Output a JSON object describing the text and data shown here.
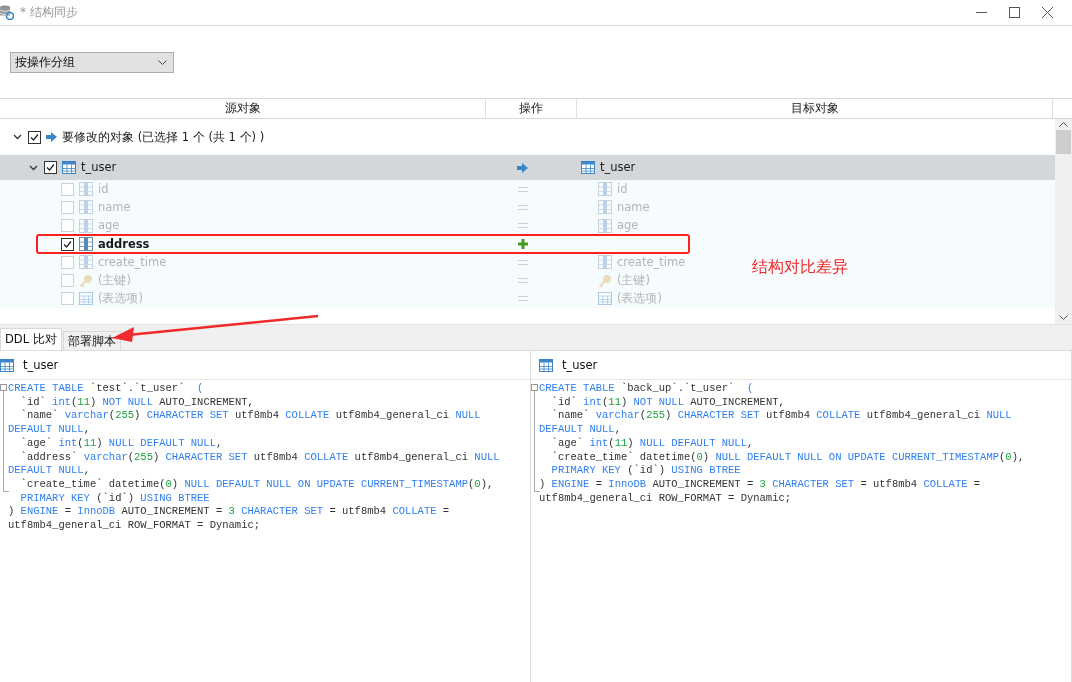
{
  "window": {
    "title": "* 结构同步"
  },
  "group_by": {
    "value": "按操作分组"
  },
  "columns": [
    "源对象",
    "操作",
    "目标对象"
  ],
  "groups": [
    {
      "label": "要修改的对象 (已选择 1 个 (共 1 个) )",
      "checked": true,
      "expanded": true,
      "op": {
        "kind": "modify"
      },
      "tables": [
        {
          "name": "t_user",
          "checked": true,
          "expanded": true,
          "selected": true,
          "op": {
            "kind": "modify"
          },
          "target": "t_user",
          "children": [
            {
              "kind": "column",
              "name": "id",
              "checked": false,
              "op": {
                "kind": "equal"
              },
              "target": "id"
            },
            {
              "kind": "column",
              "name": "name",
              "checked": false,
              "op": {
                "kind": "equal"
              },
              "target": "name"
            },
            {
              "kind": "column",
              "name": "age",
              "checked": false,
              "op": {
                "kind": "equal"
              },
              "target": "age"
            },
            {
              "kind": "column",
              "name": "address",
              "checked": true,
              "op": {
                "kind": "add"
              }
            },
            {
              "kind": "column",
              "name": "create_time",
              "checked": false,
              "op": {
                "kind": "equal"
              },
              "target": "create_time"
            },
            {
              "kind": "key",
              "name": "(主键)",
              "checked": false,
              "op": {
                "kind": "equal"
              },
              "target": "(主键)"
            },
            {
              "kind": "options",
              "name": "(表选项)",
              "checked": false,
              "op": {
                "kind": "equal"
              },
              "target": "(表选项)"
            }
          ]
        }
      ]
    }
  ],
  "annotation": {
    "label": "结构对比差异"
  },
  "tabs": [
    {
      "label": "DDL 比对",
      "selected": true
    },
    {
      "label": "部署脚本",
      "selected": false
    }
  ],
  "panes": [
    {
      "title": "t_user",
      "lines": [
        [
          {
            "t": "CREATE TABLE",
            "kind": "kw"
          },
          {
            "t": " `test`.`t_user`  ",
            "kind": "txt"
          },
          {
            "t": "(",
            "kind": "kw"
          }
        ],
        [
          {
            "t": "  `id` ",
            "kind": "txt"
          },
          {
            "t": "int",
            "kind": "kw"
          },
          {
            "t": "(",
            "kind": "txt"
          },
          {
            "t": "11",
            "kind": "num"
          },
          {
            "t": ") ",
            "kind": "txt"
          },
          {
            "t": "NOT NULL",
            "kind": "kw"
          },
          {
            "t": " AUTO_INCREMENT,",
            "kind": "txt"
          }
        ],
        [
          {
            "t": "  `name` ",
            "kind": "txt"
          },
          {
            "t": "varchar",
            "kind": "kw"
          },
          {
            "t": "(",
            "kind": "txt"
          },
          {
            "t": "255",
            "kind": "num"
          },
          {
            "t": ") ",
            "kind": "txt"
          },
          {
            "t": "CHARACTER SET",
            "kind": "kw"
          },
          {
            "t": " utf8mb4 ",
            "kind": "txt"
          },
          {
            "t": "COLLATE",
            "kind": "kw"
          },
          {
            "t": " utf8mb4_general_ci ",
            "kind": "txt"
          },
          {
            "t": "NULL",
            "kind": "kw"
          }
        ],
        [
          {
            "t": "DEFAULT NULL",
            "kind": "kw"
          },
          {
            "t": ",",
            "kind": "txt"
          }
        ],
        [
          {
            "t": "  `age` ",
            "kind": "txt"
          },
          {
            "t": "int",
            "kind": "kw"
          },
          {
            "t": "(",
            "kind": "txt"
          },
          {
            "t": "11",
            "kind": "num"
          },
          {
            "t": ") ",
            "kind": "txt"
          },
          {
            "t": "NULL DEFAULT NULL",
            "kind": "kw"
          },
          {
            "t": ",",
            "kind": "txt"
          }
        ],
        [
          {
            "t": "  `address` ",
            "kind": "txt"
          },
          {
            "t": "varchar",
            "kind": "kw"
          },
          {
            "t": "(",
            "kind": "txt"
          },
          {
            "t": "255",
            "kind": "num"
          },
          {
            "t": ") ",
            "kind": "txt"
          },
          {
            "t": "CHARACTER SET",
            "kind": "kw"
          },
          {
            "t": " utf8mb4 ",
            "kind": "txt"
          },
          {
            "t": "COLLATE",
            "kind": "kw"
          },
          {
            "t": " utf8mb4_general_ci ",
            "kind": "txt"
          },
          {
            "t": "NULL",
            "kind": "kw"
          }
        ],
        [
          {
            "t": "DEFAULT NULL",
            "kind": "kw"
          },
          {
            "t": ",",
            "kind": "txt"
          }
        ],
        [
          {
            "t": "  `create_time` datetime(",
            "kind": "txt"
          },
          {
            "t": "0",
            "kind": "num"
          },
          {
            "t": ") ",
            "kind": "txt"
          },
          {
            "t": "NULL DEFAULT NULL ON UPDATE CURRENT_TIMESTAMP",
            "kind": "kw"
          },
          {
            "t": "(",
            "kind": "txt"
          },
          {
            "t": "0",
            "kind": "num"
          },
          {
            "t": "),",
            "kind": "txt"
          }
        ],
        [
          {
            "t": "  PRIMARY KEY",
            "kind": "kw"
          },
          {
            "t": " (`id`) ",
            "kind": "txt"
          },
          {
            "t": "USING BTREE",
            "kind": "kw"
          }
        ],
        [
          {
            "t": ") ",
            "kind": "txt"
          },
          {
            "t": "ENGINE",
            "kind": "kw"
          },
          {
            "t": " = ",
            "kind": "txt"
          },
          {
            "t": "InnoDB",
            "kind": "kw"
          },
          {
            "t": " AUTO_INCREMENT = ",
            "kind": "txt"
          },
          {
            "t": "3",
            "kind": "num"
          },
          {
            "t": " CHARACTER SET",
            "kind": "kw"
          },
          {
            "t": " = utf8mb4 ",
            "kind": "txt"
          },
          {
            "t": "COLLATE",
            "kind": "kw"
          },
          {
            "t": " =",
            "kind": "txt"
          }
        ],
        [
          {
            "t": "utf8mb4_general_ci ROW_FORMAT = Dynamic;",
            "kind": "txt"
          }
        ]
      ]
    },
    {
      "title": "t_user",
      "lines": [
        [
          {
            "t": "CREATE TABLE",
            "kind": "kw"
          },
          {
            "t": " `back_up`.`t_user`  ",
            "kind": "txt"
          },
          {
            "t": "(",
            "kind": "kw"
          }
        ],
        [
          {
            "t": "  `id` ",
            "kind": "txt"
          },
          {
            "t": "int",
            "kind": "kw"
          },
          {
            "t": "(",
            "kind": "txt"
          },
          {
            "t": "11",
            "kind": "num"
          },
          {
            "t": ") ",
            "kind": "txt"
          },
          {
            "t": "NOT NULL",
            "kind": "kw"
          },
          {
            "t": " AUTO_INCREMENT,",
            "kind": "txt"
          }
        ],
        [
          {
            "t": "  `name` ",
            "kind": "txt"
          },
          {
            "t": "varchar",
            "kind": "kw"
          },
          {
            "t": "(",
            "kind": "txt"
          },
          {
            "t": "255",
            "kind": "num"
          },
          {
            "t": ") ",
            "kind": "txt"
          },
          {
            "t": "CHARACTER SET",
            "kind": "kw"
          },
          {
            "t": " utf8mb4 ",
            "kind": "txt"
          },
          {
            "t": "COLLATE",
            "kind": "kw"
          },
          {
            "t": " utf8mb4_general_ci ",
            "kind": "txt"
          },
          {
            "t": "NULL",
            "kind": "kw"
          }
        ],
        [
          {
            "t": "DEFAULT NULL",
            "kind": "kw"
          },
          {
            "t": ",",
            "kind": "txt"
          }
        ],
        [
          {
            "t": "  `age` ",
            "kind": "txt"
          },
          {
            "t": "int",
            "kind": "kw"
          },
          {
            "t": "(",
            "kind": "txt"
          },
          {
            "t": "11",
            "kind": "num"
          },
          {
            "t": ") ",
            "kind": "txt"
          },
          {
            "t": "NULL DEFAULT NULL",
            "kind": "kw"
          },
          {
            "t": ",",
            "kind": "txt"
          }
        ],
        [
          {
            "t": "  `create_time` datetime(",
            "kind": "txt"
          },
          {
            "t": "0",
            "kind": "num"
          },
          {
            "t": ") ",
            "kind": "txt"
          },
          {
            "t": "NULL DEFAULT NULL ON UPDATE CURRENT_TIMESTAMP",
            "kind": "kw"
          },
          {
            "t": "(",
            "kind": "txt"
          },
          {
            "t": "0",
            "kind": "num"
          },
          {
            "t": "),",
            "kind": "txt"
          }
        ],
        [
          {
            "t": "  PRIMARY KEY",
            "kind": "kw"
          },
          {
            "t": " (`id`) ",
            "kind": "txt"
          },
          {
            "t": "USING BTREE",
            "kind": "kw"
          }
        ],
        [
          {
            "t": ") ",
            "kind": "txt"
          },
          {
            "t": "ENGINE",
            "kind": "kw"
          },
          {
            "t": " = ",
            "kind": "txt"
          },
          {
            "t": "InnoDB",
            "kind": "kw"
          },
          {
            "t": " AUTO_INCREMENT = ",
            "kind": "txt"
          },
          {
            "t": "3",
            "kind": "num"
          },
          {
            "t": " CHARACTER SET",
            "kind": "kw"
          },
          {
            "t": " = utf8mb4 ",
            "kind": "txt"
          },
          {
            "t": "COLLATE",
            "kind": "kw"
          },
          {
            "t": " =",
            "kind": "txt"
          }
        ],
        [
          {
            "t": "utf8mb4_general_ci ROW_FORMAT = Dynamic;",
            "kind": "txt"
          }
        ]
      ]
    }
  ]
}
